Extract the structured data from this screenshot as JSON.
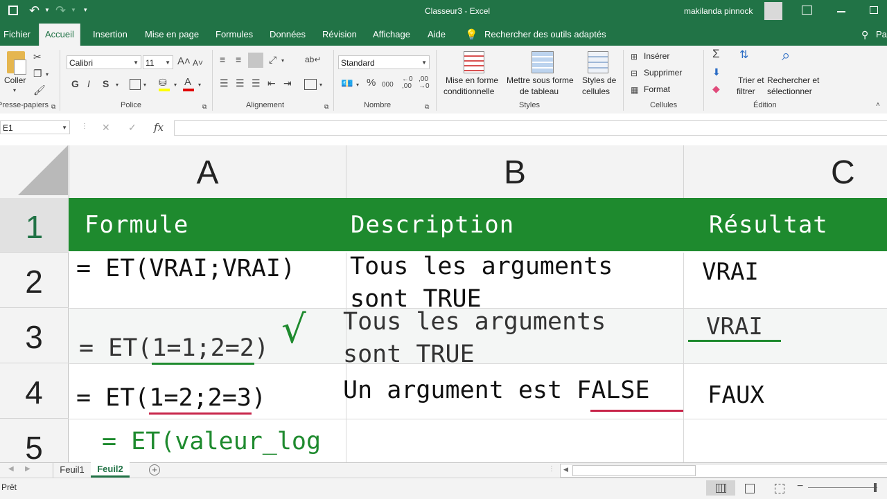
{
  "title_bar": {
    "title": "Classeur3  -  Excel",
    "user": "makilanda pinnock"
  },
  "tabs": [
    "Fichier",
    "Accueil",
    "Insertion",
    "Mise en page",
    "Formules",
    "Données",
    "Révision",
    "Affichage",
    "Aide"
  ],
  "tell_me": "Rechercher des outils adaptés",
  "share": "Par",
  "ribbon": {
    "paste": "Coller",
    "clipboard_group": "Presse-papiers",
    "font_name": "Calibri",
    "font_size": "11",
    "bold": "G",
    "italic": "I",
    "underline": "S",
    "font_group": "Police",
    "align_group": "Alignement",
    "number_format": "Standard",
    "percent": "%",
    "thousands": "000",
    "number_group": "Nombre",
    "cond_format_1": "Mise en forme",
    "cond_format_2": "conditionnelle",
    "table_format_1": "Mettre sous forme",
    "table_format_2": "de tableau",
    "cell_styles_1": "Styles de",
    "cell_styles_2": "cellules",
    "styles_group": "Styles",
    "insert": "Insérer",
    "delete": "Supprimer",
    "format": "Format",
    "cells_group": "Cellules",
    "sort_1": "Trier et",
    "sort_2": "filtrer",
    "find_1": "Rechercher et",
    "find_2": "sélectionner",
    "editing_group": "Édition"
  },
  "formula_bar": {
    "name_box": "E1",
    "fx": "fx",
    "value": ""
  },
  "columns": [
    "A",
    "B",
    "C"
  ],
  "rows": [
    "1",
    "2",
    "3",
    "4",
    "5"
  ],
  "header_row": {
    "a": "Formule",
    "b": "Description",
    "c": "Résultat",
    "fill": "#1e8a2e"
  },
  "data_rows": [
    {
      "a": "= ET(VRAI;VRAI)",
      "b1": "Tous les arguments",
      "b2": "sont TRUE",
      "c": "VRAI"
    },
    {
      "a_prefix": "= ET(",
      "a_mid": "1=1;2=2",
      "a_suffix": ")",
      "b1": "Tous les arguments",
      "b2": "sont TRUE",
      "c": "VRAI",
      "mark": "√"
    },
    {
      "a_prefix": "= ET(",
      "a_mid": "1=2;2=3",
      "a_suffix": ")",
      "b_pre": "Un argument est ",
      "b_emph": "FALSE",
      "c": "FAUX"
    },
    {
      "a": "= ET(valeur_log"
    }
  ],
  "colors": {
    "excel_green": "#217346",
    "ok_green": "#1e8a2e",
    "error_red": "#c8254a"
  },
  "sheets": [
    "Feuil1",
    "Feuil2"
  ],
  "active_sheet": "Feuil2",
  "status": "Prêt"
}
